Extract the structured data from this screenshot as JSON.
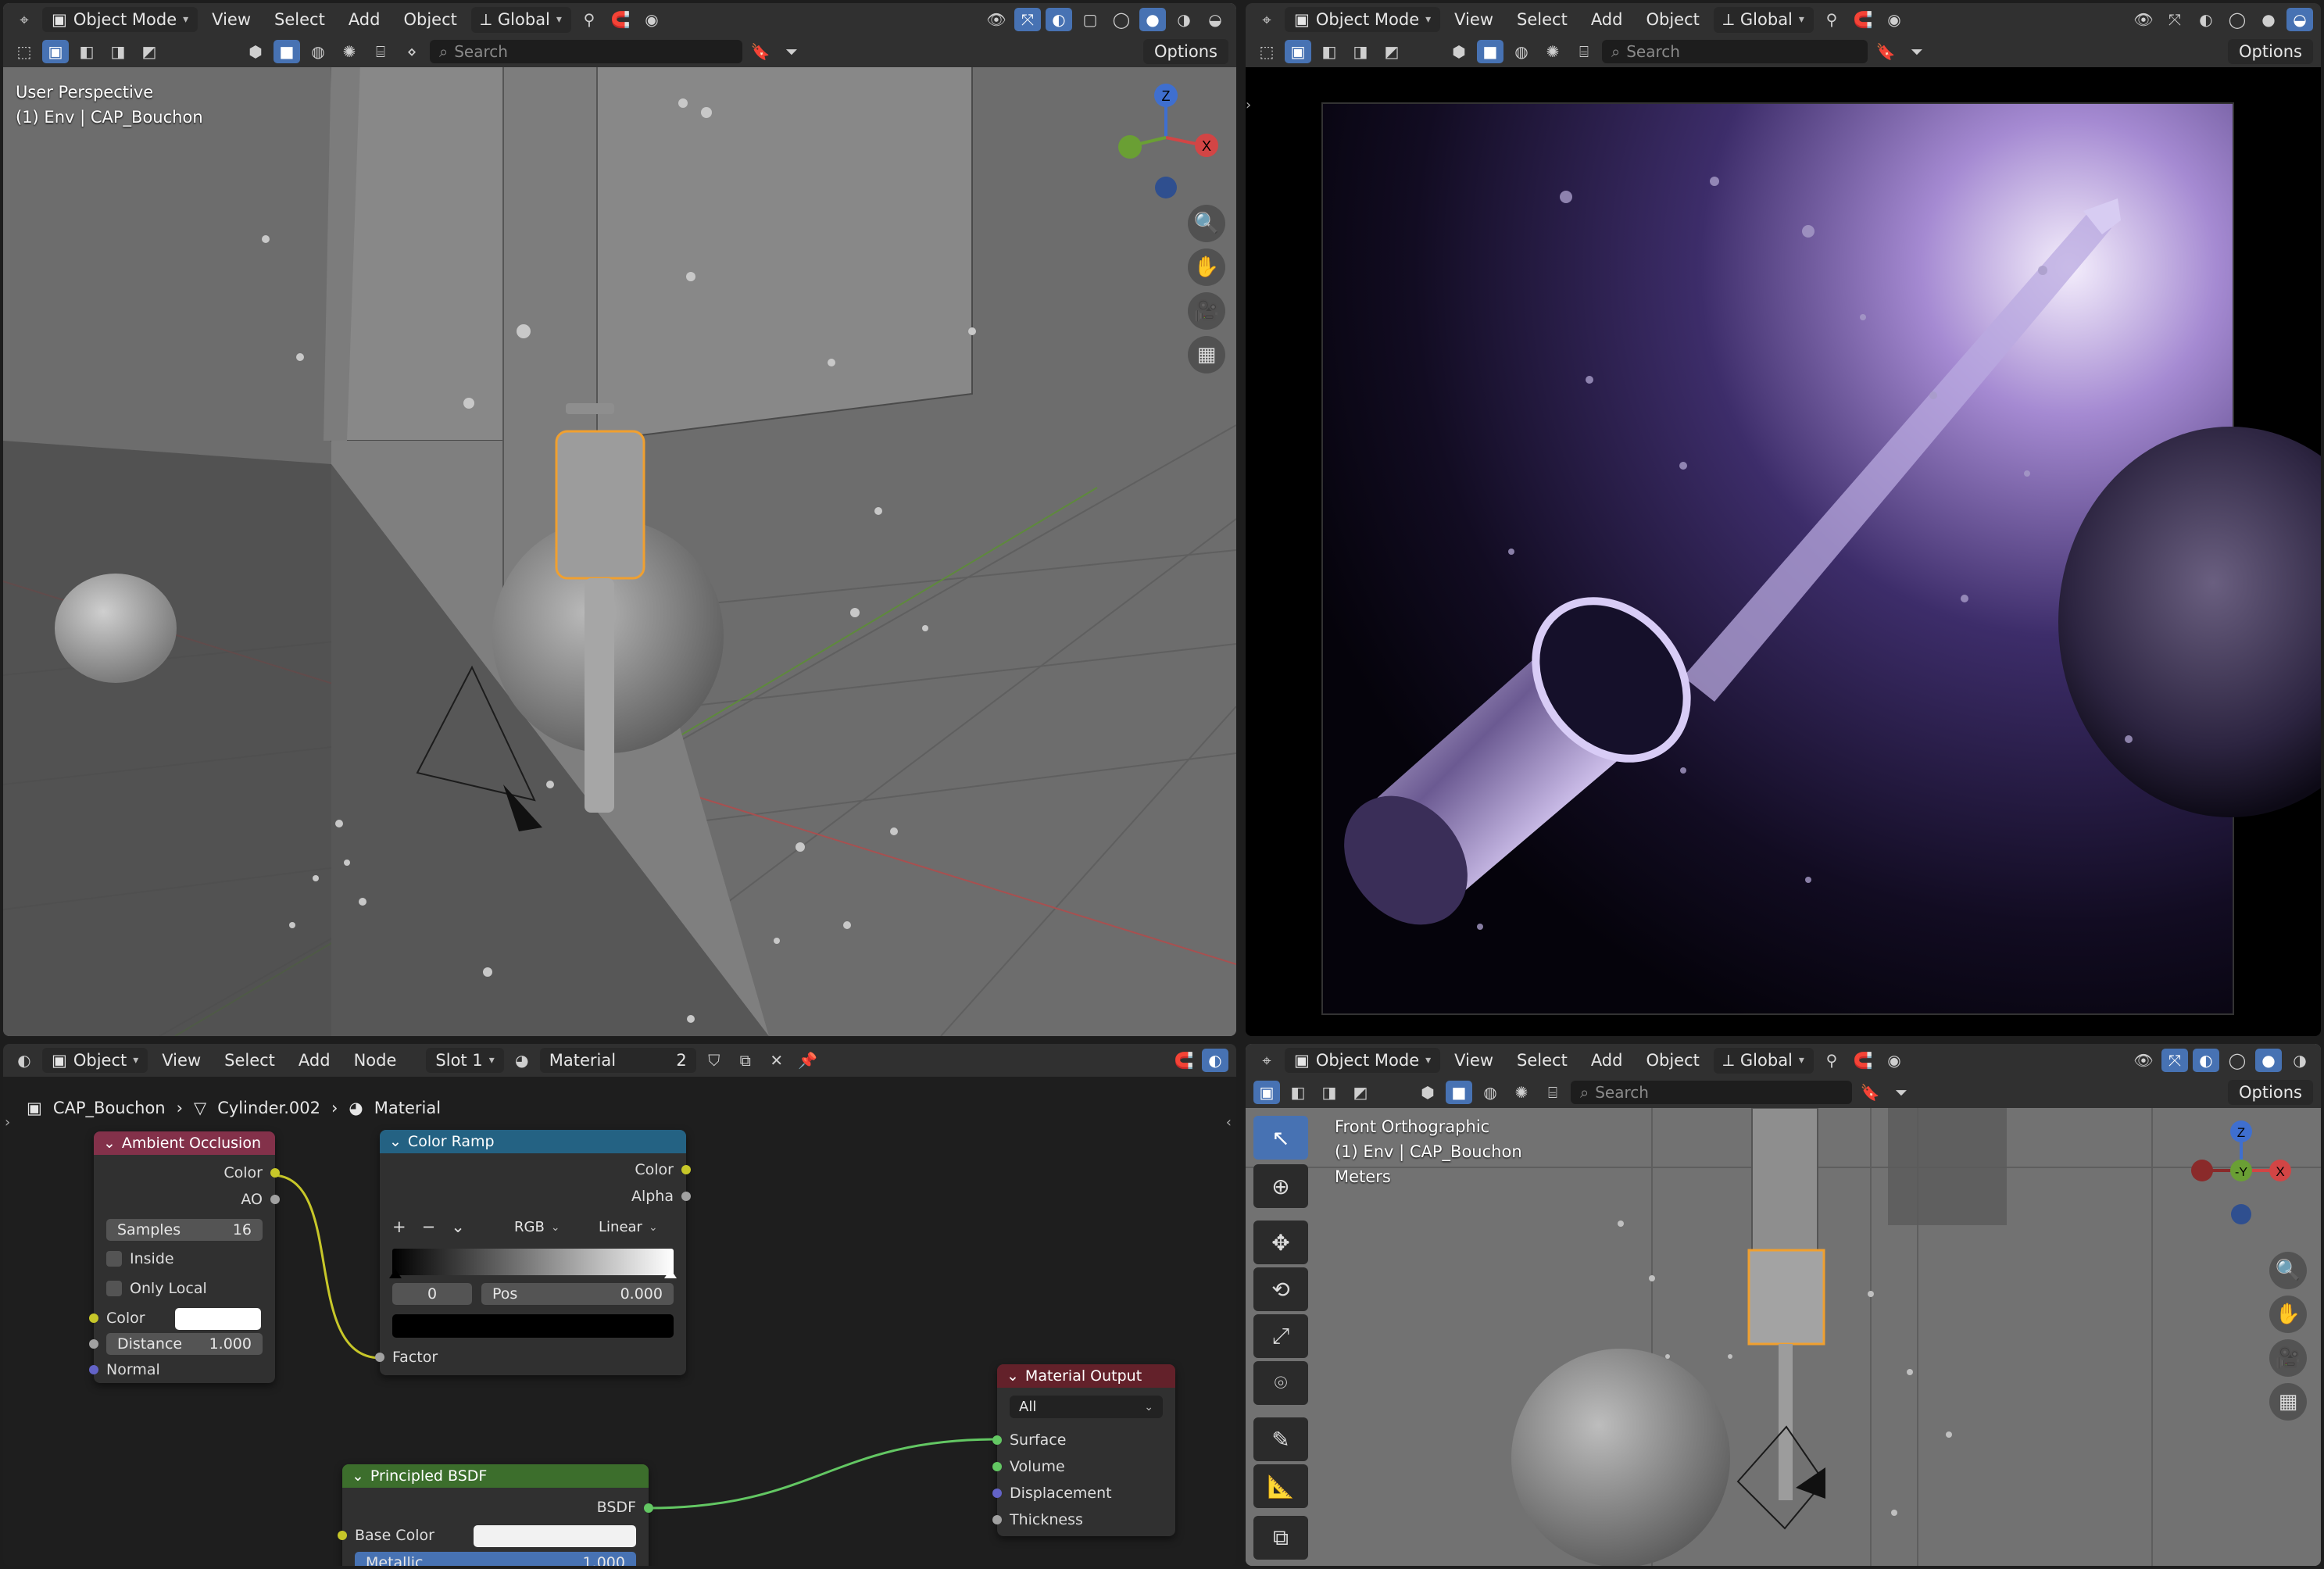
{
  "viewport3d": {
    "mode": "Object Mode",
    "menus": [
      "View",
      "Select",
      "Add",
      "Object"
    ],
    "transform": "Global",
    "search_placeholder": "Search",
    "options": "Options",
    "perspective": "User Perspective",
    "collection": "(1) Env | CAP_Bouchon",
    "gizmo": {
      "z": "Z",
      "x": "X"
    }
  },
  "render_view": {
    "mode": "Object Mode",
    "menus": [
      "View",
      "Select",
      "Add",
      "Object"
    ],
    "transform": "Global",
    "search_placeholder": "Search",
    "options": "Options"
  },
  "node_editor": {
    "type": "Object",
    "menus": [
      "View",
      "Select",
      "Add",
      "Node"
    ],
    "slot": "Slot 1",
    "material": "Material",
    "users": "2",
    "breadcrumb": [
      "CAP_Bouchon",
      "Cylinder.002",
      "Material"
    ],
    "ao_node": {
      "title": "Ambient Occlusion",
      "out_color": "Color",
      "out_ao": "AO",
      "samples_label": "Samples",
      "samples": "16",
      "inside": "Inside",
      "only_local": "Only Local",
      "in_color": "Color",
      "distance_label": "Distance",
      "distance": "1.000",
      "normal": "Normal"
    },
    "ramp_node": {
      "title": "Color Ramp",
      "out_color": "Color",
      "out_alpha": "Alpha",
      "plus": "+",
      "minus": "−",
      "color_mode": "RGB",
      "interp": "Linear",
      "index": "0",
      "pos_label": "Pos",
      "pos": "0.000",
      "factor": "Factor"
    },
    "output_node": {
      "title": "Material Output",
      "target": "All",
      "inputs": [
        "Surface",
        "Volume",
        "Displacement",
        "Thickness"
      ]
    },
    "bsdf_node": {
      "title": "Principled BSDF",
      "out": "BSDF",
      "base_color": "Base Color",
      "metallic_label": "Metallic",
      "metallic": "1.000"
    }
  },
  "front_view": {
    "mode": "Object Mode",
    "menus": [
      "View",
      "Select",
      "Add",
      "Object"
    ],
    "transform": "Global",
    "search_placeholder": "Search",
    "options": "Options",
    "view_name": "Front Orthographic",
    "collection": "(1) Env | CAP_Bouchon",
    "units": "Meters",
    "gizmo": {
      "z": "Z",
      "y": "-Y",
      "x": "X"
    }
  },
  "colors": {
    "accent": "#4772b3",
    "selected_outline": "#f0a030",
    "node_ao_header": "#83314a",
    "node_ramp_header": "#246283",
    "node_output_header": "#63212a",
    "node_bsdf_header": "#3c6e2c",
    "socket_yellow": "#c7c729",
    "socket_gray": "#a1a1a1",
    "socket_blue": "#6363c7",
    "socket_green": "#63c763"
  }
}
